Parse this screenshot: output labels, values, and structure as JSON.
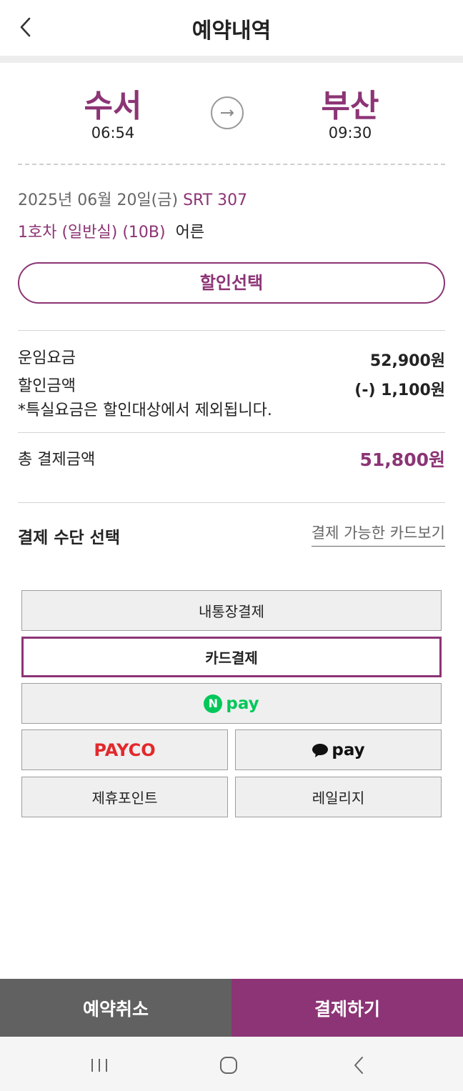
{
  "header": {
    "title": "예약내역",
    "back_icon": "chevron-left-icon"
  },
  "route": {
    "from_station": "수서",
    "from_time": "06:54",
    "to_station": "부산",
    "to_time": "09:30",
    "arrow_icon": "arrow-right-circle-icon"
  },
  "trip": {
    "date": "2025년 06월 20일(금)",
    "train": "SRT 307",
    "seat": "1호차 (일반실) (10B)",
    "passenger": "어른"
  },
  "discount_button": "할인선택",
  "fare": {
    "fare_label": "운임요금",
    "fare_value": "52,900원",
    "discount_label": "할인금액",
    "discount_value": "(-) 1,100원",
    "note": "*특실요금은 할인대상에서 제외됩니다.",
    "total_label": "총 결제금액",
    "total_value": "51,800원"
  },
  "payment": {
    "title": "결제 수단 선택",
    "card_link": "결제 가능한 카드보기",
    "bank": "내통장결제",
    "card": "카드결제",
    "npay_mark": "N",
    "npay_text": "pay",
    "payco": "PAYCO",
    "kakaopay_text": "pay",
    "points": "제휴포인트",
    "mileage": "레일리지"
  },
  "actions": {
    "cancel": "예약취소",
    "pay": "결제하기"
  },
  "colors": {
    "accent": "#8c3475",
    "cancel_bg": "#616161",
    "npay_green": "#03c75a",
    "payco_red": "#e3282b"
  },
  "system_nav": {
    "recent_icon": "recent-apps-icon",
    "home_icon": "home-icon",
    "back_icon": "system-back-icon"
  }
}
